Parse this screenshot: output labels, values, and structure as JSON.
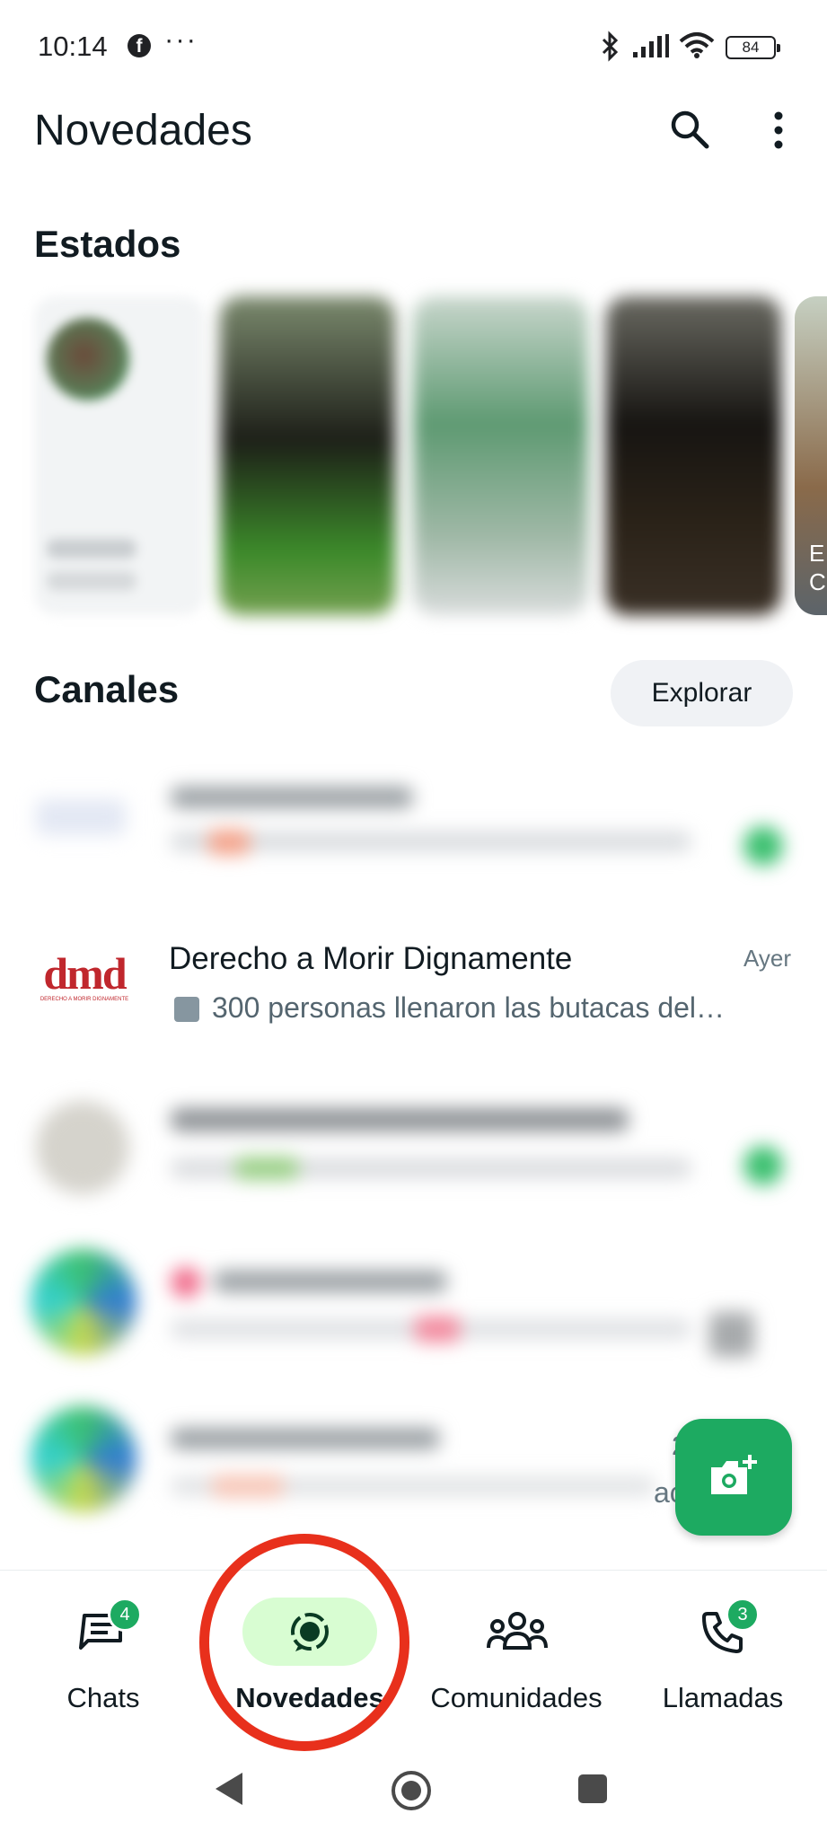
{
  "status_bar": {
    "time": "10:14",
    "facebook_glyph": "f",
    "more_glyph": "···",
    "battery": "84"
  },
  "header": {
    "title": "Novedades",
    "search_icon": "search-icon",
    "menu_icon": "more-vert-icon"
  },
  "statuses": {
    "title": "Estados",
    "partial_label": "E\nC"
  },
  "channels": {
    "title": "Canales",
    "explore_label": "Explorar",
    "items": [
      {
        "name": "Derecho a Morir Dignamente",
        "preview": "300 personas llenaron las butacas del…",
        "time": "Ayer",
        "logo_text": "dmd",
        "logo_subtext": "DERECHO A MORIR DIGNAMENTE"
      }
    ],
    "partial_time": "2",
    "partial_preview": "ac"
  },
  "fab": {
    "icon": "camera-add-icon"
  },
  "bottom_nav": {
    "items": [
      {
        "label": "Chats",
        "badge": "4",
        "icon": "chats-icon"
      },
      {
        "label": "Novedades",
        "icon": "updates-icon",
        "active": true
      },
      {
        "label": "Comunidades",
        "icon": "communities-icon"
      },
      {
        "label": "Llamadas",
        "badge": "3",
        "icon": "phone-icon"
      }
    ]
  },
  "colors": {
    "accent": "#1daa61",
    "active_pill": "#d8fdd2",
    "annotation": "#e8301c"
  }
}
